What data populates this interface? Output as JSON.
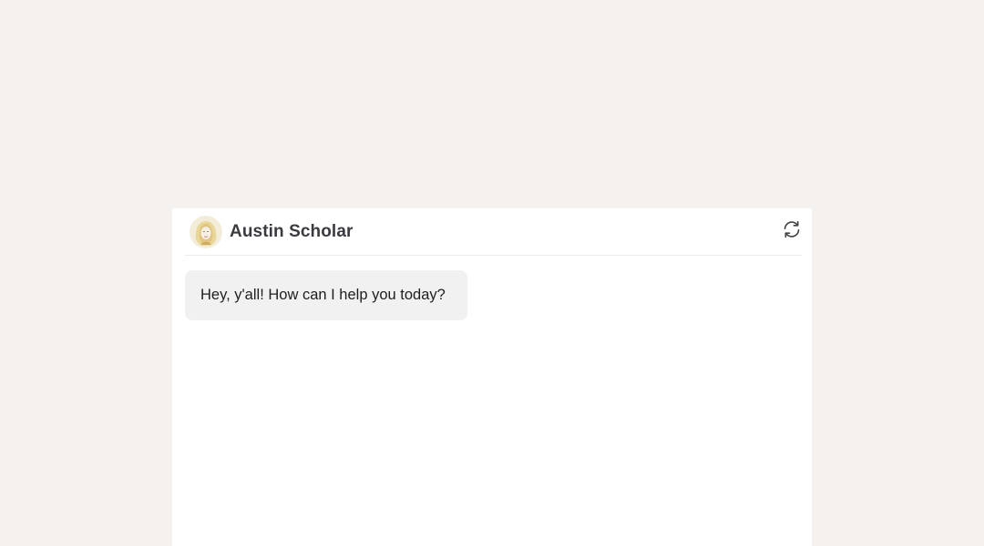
{
  "chat": {
    "agent_name": "Austin Scholar",
    "avatar_icon": "avatar-portrait-icon",
    "refresh_icon": "refresh-icon",
    "messages": [
      {
        "sender": "agent",
        "text": "Hey, y'all! How can I help you today?"
      }
    ]
  },
  "colors": {
    "page_background": "#f5f1ee",
    "panel_background": "#ffffff",
    "bubble_background": "#f1f1f1",
    "name_text": "#3a3a40"
  }
}
